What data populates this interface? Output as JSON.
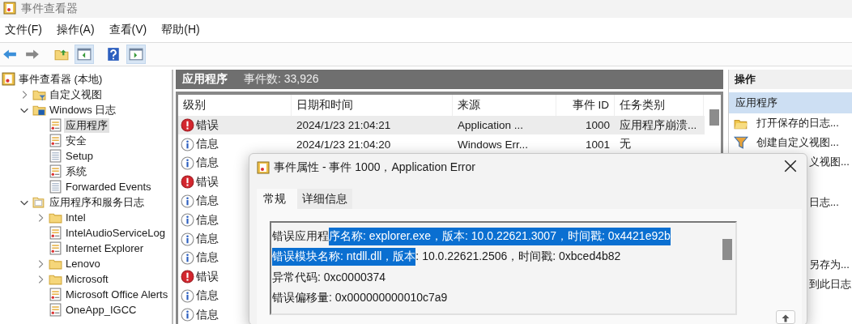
{
  "window": {
    "title": "事件查看器"
  },
  "menu": [
    "文件(F)",
    "操作(A)",
    "查看(V)",
    "帮助(H)"
  ],
  "toolbar": [
    {
      "kind": "back",
      "on": false
    },
    {
      "kind": "forward",
      "on": false
    },
    {
      "kind": "folder-up",
      "on": false
    },
    {
      "kind": "panel-left",
      "on": true
    },
    {
      "kind": "help",
      "on": false
    },
    {
      "kind": "panel-right",
      "on": true
    }
  ],
  "tree": [
    {
      "label": "事件查看器 (本地)",
      "kind": "viewer",
      "selected": false,
      "children": [
        {
          "label": "自定义视图",
          "kind": "filter-folder",
          "selected": false,
          "expanded": false
        },
        {
          "label": "Windows 日志",
          "kind": "win-folder",
          "selected": false,
          "expanded": true,
          "children": [
            {
              "label": "应用程序",
              "kind": "log",
              "selected": true
            },
            {
              "label": "安全",
              "kind": "log",
              "selected": false
            },
            {
              "label": "Setup",
              "kind": "plain-log",
              "selected": false
            },
            {
              "label": "系统",
              "kind": "log",
              "selected": false
            },
            {
              "label": "Forwarded Events",
              "kind": "plain-log",
              "selected": false
            }
          ]
        },
        {
          "label": "应用程序和服务日志",
          "kind": "open-folder",
          "selected": false,
          "expanded": true,
          "children": [
            {
              "label": "Intel",
              "kind": "folder",
              "selected": false,
              "expanded": false
            },
            {
              "label": "IntelAudioServiceLog",
              "kind": "log",
              "selected": false
            },
            {
              "label": "Internet Explorer",
              "kind": "log",
              "selected": false
            },
            {
              "label": "Lenovo",
              "kind": "folder",
              "selected": false,
              "expanded": false
            },
            {
              "label": "Microsoft",
              "kind": "folder",
              "selected": false,
              "expanded": false
            },
            {
              "label": "Microsoft Office Alerts",
              "kind": "log",
              "selected": false
            },
            {
              "label": "OneApp_IGCC",
              "kind": "log",
              "selected": false
            }
          ]
        }
      ]
    }
  ],
  "log_panel": {
    "title": "应用程序",
    "count": "事件数: 33,926",
    "columns": [
      "级别",
      "日期和时间",
      "来源",
      "事件 ID",
      "任务类别"
    ],
    "rows": [
      {
        "kind": "error",
        "level_text": "错误",
        "date": "2024/1/23 21:04:21",
        "source": "Application ...",
        "id": "1000",
        "task": "应用程序崩溃...",
        "selected": true
      },
      {
        "kind": "info",
        "level_text": "信息",
        "date": "2024/1/23 21:04:20",
        "source": "Windows Err...",
        "id": "1001",
        "task": "无",
        "selected": false
      },
      {
        "kind": "info",
        "level_text": "信息",
        "selected": false
      },
      {
        "kind": "error",
        "level_text": "错误",
        "selected": false
      },
      {
        "kind": "info",
        "level_text": "信息",
        "selected": false
      },
      {
        "kind": "info",
        "level_text": "信息",
        "selected": false
      },
      {
        "kind": "info",
        "level_text": "信息",
        "selected": false
      },
      {
        "kind": "info",
        "level_text": "信息",
        "selected": false
      },
      {
        "kind": "error",
        "level_text": "错误",
        "selected": false
      },
      {
        "kind": "info",
        "level_text": "信息",
        "selected": false
      },
      {
        "kind": "info",
        "level_text": "信息",
        "selected": false
      }
    ]
  },
  "actions": {
    "title": "操作",
    "section": "应用程序",
    "items": [
      {
        "label": "打开保存的日志...",
        "kind": "folder"
      },
      {
        "label": "创建自定义视图...",
        "kind": "filter"
      },
      {
        "label": "义视图...",
        "kind": "cut"
      },
      {
        "label": "日志...",
        "kind": "cut-gap"
      },
      {
        "label": "另存为...",
        "kind": "cut-gap2"
      },
      {
        "label": "到此日志",
        "kind": "cut"
      }
    ]
  },
  "dialog": {
    "title": "事件属性 - 事件 1000，Application Error",
    "tabs": [
      {
        "label": "常规",
        "selected": true
      },
      {
        "label": "详细信息",
        "selected": false
      }
    ],
    "lines": [
      {
        "before": "错误应用程",
        "highlighted": "序名称: explorer.exe，版本: 10.0.22621.3007，时间戳: 0x4421e92b"
      },
      {
        "highlighted": "错误模块名称: ntdll.dll，版本",
        "after": ": 10.0.22621.2506，时间戳: 0xbced4b82"
      },
      {
        "before": "异常代码: 0xc0000374"
      },
      {
        "before": "错误偏移量: 0x000000000010c7a9"
      }
    ]
  }
}
